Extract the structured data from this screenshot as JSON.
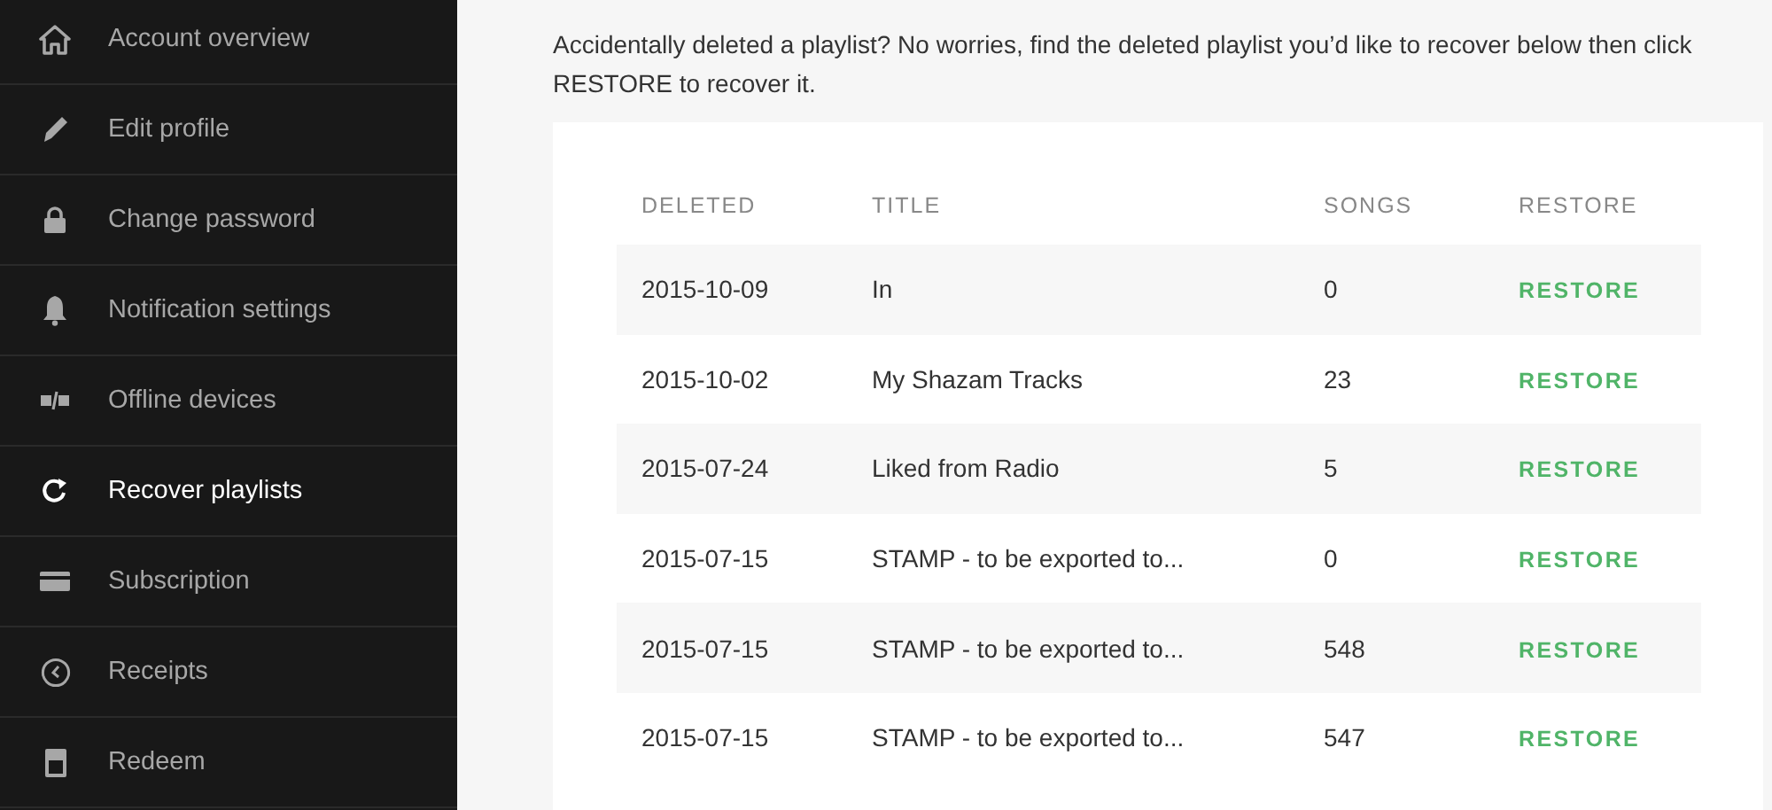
{
  "sidebar": {
    "items": [
      {
        "label": "Account overview",
        "selected": false
      },
      {
        "label": "Edit profile",
        "selected": false
      },
      {
        "label": "Change password",
        "selected": false
      },
      {
        "label": "Notification settings",
        "selected": false
      },
      {
        "label": "Offline devices",
        "selected": false
      },
      {
        "label": "Recover playlists",
        "selected": true
      },
      {
        "label": "Subscription",
        "selected": false
      },
      {
        "label": "Receipts",
        "selected": false
      },
      {
        "label": "Redeem",
        "selected": false
      }
    ]
  },
  "intro": "Accidentally deleted a playlist? No worries, find the deleted playlist you’d like to recover below then click RESTORE to recover it.",
  "table": {
    "columns": [
      "DELETED",
      "TITLE",
      "SONGS",
      "RESTORE"
    ],
    "rows": [
      {
        "deleted": "2015-10-09",
        "title": "In",
        "songs": "0",
        "action": "RESTORE"
      },
      {
        "deleted": "2015-10-02",
        "title": "My Shazam Tracks",
        "songs": "23",
        "action": "RESTORE"
      },
      {
        "deleted": "2015-07-24",
        "title": "Liked from Radio",
        "songs": "5",
        "action": "RESTORE"
      },
      {
        "deleted": "2015-07-15",
        "title": "STAMP - to be exported to...",
        "songs": "0",
        "action": "RESTORE"
      },
      {
        "deleted": "2015-07-15",
        "title": "STAMP - to be exported to...",
        "songs": "548",
        "action": "RESTORE"
      },
      {
        "deleted": "2015-07-15",
        "title": "STAMP - to be exported to...",
        "songs": "547",
        "action": "RESTORE"
      }
    ]
  }
}
